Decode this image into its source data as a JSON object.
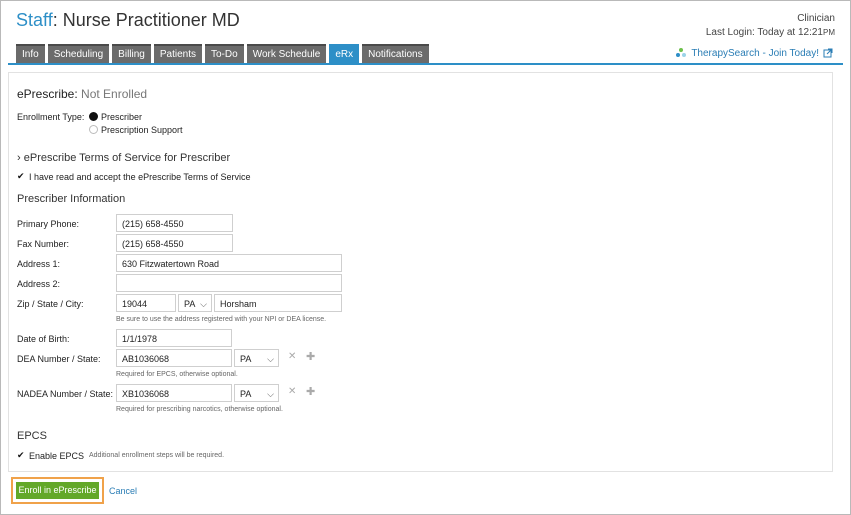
{
  "header": {
    "staff_label": "Staff",
    "title": ": Nurse Practitioner MD",
    "role": "Clinician",
    "last_login": "Last Login: Today at 12:21",
    "last_login_suffix": "PM"
  },
  "tabs": [
    {
      "label": "Info"
    },
    {
      "label": "Scheduling"
    },
    {
      "label": "Billing"
    },
    {
      "label": "Patients"
    },
    {
      "label": "To-Do"
    },
    {
      "label": "Work Schedule"
    },
    {
      "label": "eRx"
    },
    {
      "label": "Notifications"
    }
  ],
  "therapy_search": "TherapySearch - Join Today!",
  "eprescribe": {
    "heading": "ePrescribe:",
    "status": "Not Enrolled",
    "enrollment_type_label": "Enrollment Type:",
    "options": [
      "Prescriber",
      "Prescription Support"
    ],
    "terms_heading": "ePrescribe Terms of Service for Prescriber",
    "terms_accept": "I have read and accept the ePrescribe Terms of Service"
  },
  "prescriber": {
    "heading": "Prescriber Information",
    "primary_phone_label": "Primary Phone:",
    "primary_phone": "(215) 658-4550",
    "fax_label": "Fax Number:",
    "fax": "(215) 658-4550",
    "address1_label": "Address 1:",
    "address1": "630 Fitzwatertown Road",
    "address2_label": "Address 2:",
    "address2": "",
    "zip_label": "Zip / State / City:",
    "zip": "19044",
    "state": "PA",
    "city": "Horsham",
    "zip_hint": "Be sure to use the address registered with your NPI or DEA license.",
    "dob_label": "Date of Birth:",
    "dob": "1/1/1978",
    "dea_label": "DEA Number / State:",
    "dea": "AB1036068",
    "dea_state": "PA",
    "dea_hint": "Required for EPCS, otherwise optional.",
    "nadea_label": "NADEA Number / State:",
    "nadea": "XB1036068",
    "nadea_state": "PA",
    "nadea_hint": "Required for prescribing narcotics, otherwise optional."
  },
  "epcs": {
    "heading": "EPCS",
    "enable_label": "Enable EPCS",
    "enable_hint": "Additional enrollment steps will be required."
  },
  "actions": {
    "enroll": "Enroll in ePrescribe",
    "cancel": "Cancel"
  }
}
